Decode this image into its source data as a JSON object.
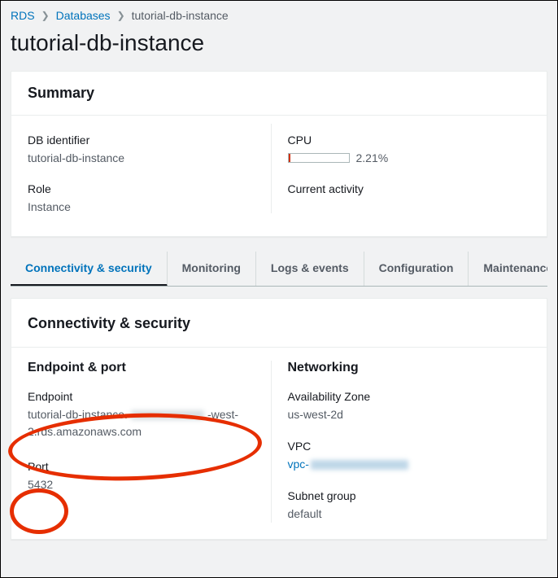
{
  "breadcrumb": {
    "rds": "RDS",
    "databases": "Databases",
    "current": "tutorial-db-instance"
  },
  "page_title": "tutorial-db-instance",
  "summary": {
    "heading": "Summary",
    "db_identifier_label": "DB identifier",
    "db_identifier_value": "tutorial-db-instance",
    "role_label": "Role",
    "role_value": "Instance",
    "cpu_label": "CPU",
    "cpu_value": "2.21%",
    "current_activity_label": "Current activity"
  },
  "tabs": {
    "connectivity": "Connectivity & security",
    "monitoring": "Monitoring",
    "logs": "Logs & events",
    "configuration": "Configuration",
    "maintenance": "Maintenance"
  },
  "connectivity": {
    "heading": "Connectivity & security",
    "endpoint_port_heading": "Endpoint & port",
    "endpoint_label": "Endpoint",
    "endpoint_prefix": "tutorial-db-instance.",
    "endpoint_suffix": "-west-2.rds.amazonaws.com",
    "port_label": "Port",
    "port_value": "5432",
    "networking_heading": "Networking",
    "az_label": "Availability Zone",
    "az_value": "us-west-2d",
    "vpc_label": "VPC",
    "vpc_prefix": "vpc-",
    "subnet_group_label": "Subnet group",
    "subnet_group_value": "default"
  }
}
